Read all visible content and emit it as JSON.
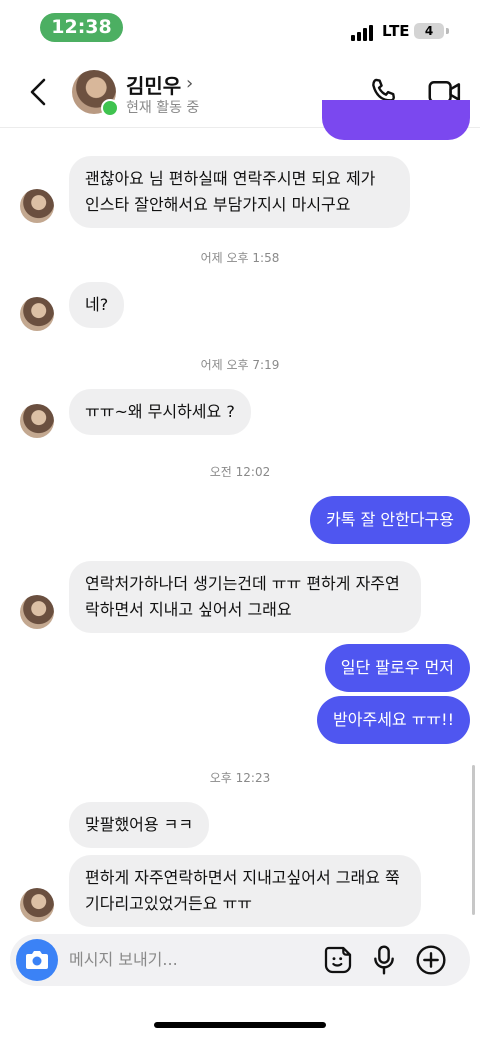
{
  "status_bar": {
    "time": "12:38",
    "network": "LTE",
    "battery": "4"
  },
  "header": {
    "contact_name": "김민우",
    "chevron": "›",
    "activity": "현재 활동 중",
    "icons": {
      "back": "chevron-left-icon",
      "call": "phone-icon",
      "video": "video-camera-icon"
    }
  },
  "messages": {
    "m1": "괜찮아요 님 편하실때 연락주시면 되요 제가 인스타 잘안해서요 부담가지시 마시구요",
    "t1": "어제 오후 1:58",
    "m2": "네?",
    "t2": "어제 오후 7:19",
    "m3": "ㅠㅠ~왜 무시하세요 ?",
    "t3": "오전 12:02",
    "m4": "카톡 잘 안한다구용",
    "m5": "연락처가하나더 생기는건데  ㅠㅠ 편하게 자주연락하면서 지내고 싶어서 그래요",
    "m6": "일단 팔로우 먼저",
    "m7": "받아주세요 ㅠㅠ!!",
    "t4": "오후 12:23",
    "m8": "맞팔했어용 ㅋㅋ",
    "m9": "편하게 자주연락하면서 지내고싶어서 그래요 쭉 기다리고있었거든요 ㅠㅠ"
  },
  "composer": {
    "placeholder": "메시지 보내기...",
    "icons": {
      "camera": "camera-icon",
      "sticker": "sticker-icon",
      "mic": "microphone-icon",
      "add": "plus-circle-icon"
    }
  },
  "colors": {
    "outgoing": "#4f56f0",
    "incoming": "#efeff0",
    "online": "#3fc34f",
    "time_pill": "#4caf62",
    "camera": "#3b82f6"
  }
}
